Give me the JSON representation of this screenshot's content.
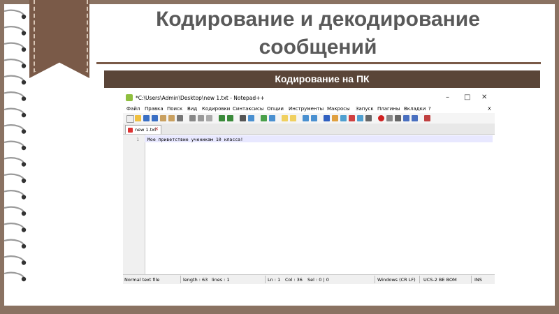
{
  "slide": {
    "title": "Кодирование и декодирование сообщений",
    "subtitle": "Кодирование на ПК"
  },
  "notepad": {
    "window_title": "*C:\\Users\\Admin\\Desktop\\new 1.txt - Notepad++",
    "controls": {
      "minimize": "–",
      "maximize": "□",
      "close": "✕"
    },
    "menu": [
      "Файл",
      "Правка",
      "Поиск",
      "Вид",
      "Кодировки",
      "Синтаксисы",
      "Опции",
      "Инструменты",
      "Макросы",
      "Запуск",
      "Плагины",
      "Вкладки",
      "?"
    ],
    "menu_close": "X",
    "tab": {
      "label": "new 1.txt",
      "close": "✕"
    },
    "line_number": "1",
    "content": "Мое приветствие ученикам 10 класса!",
    "status": {
      "file_type": "Normal text file",
      "length": "length : 63",
      "lines": "lines : 1",
      "ln": "Ln : 1",
      "col": "Col : 36",
      "sel": "Sel : 0 | 0",
      "eol": "Windows (CR LF)",
      "encoding": "UCS-2 BE BOM",
      "mode": "INS"
    },
    "colors": {
      "accent": "#5a4538",
      "ribbon": "#7a5a48",
      "current_line": "#e8e8ff"
    }
  }
}
